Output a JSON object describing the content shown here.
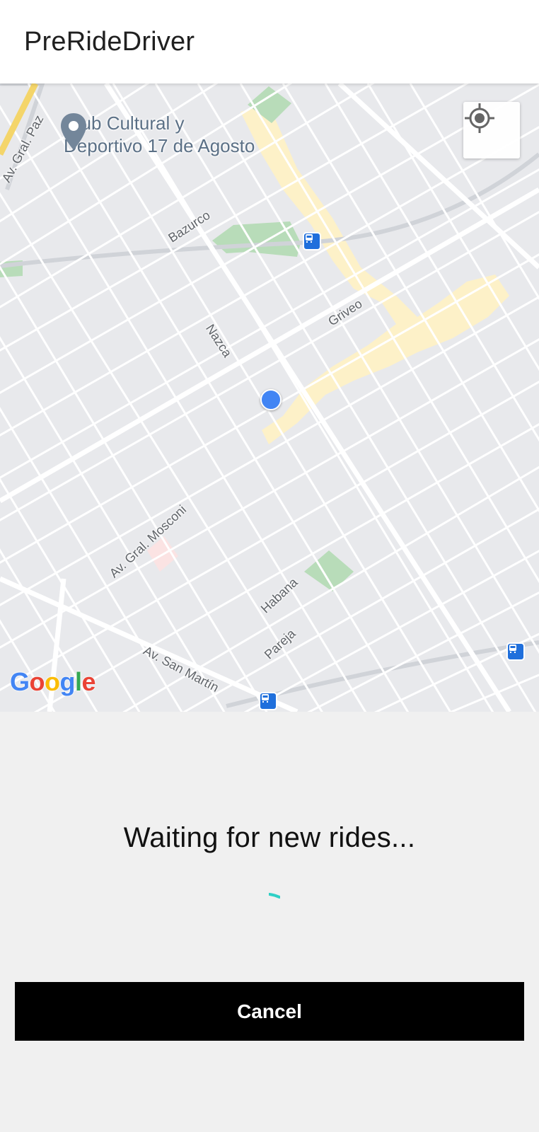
{
  "app": {
    "title": "PreRideDriver"
  },
  "map": {
    "poi": {
      "name_line1": "Club Cultural y",
      "name_line2": "Deportivo 17 de Agosto",
      "icon": "map-pin-icon"
    },
    "street_labels": {
      "gral_paz": "Av. Gral. Paz",
      "bazurco": "Bazurco",
      "nazca": "Nazca",
      "griveo": "Griveo",
      "mosconi": "Av. Gral. Mosconi",
      "habana": "Habana",
      "pareja": "Pareja",
      "san_martin": "Av. San Martín"
    },
    "attribution": {
      "G": "G",
      "o1": "o",
      "o2": "o",
      "g": "g",
      "l": "l",
      "e": "e"
    },
    "icons": {
      "locate": "my-location-icon",
      "transit": "train-station-icon",
      "user": "user-location-dot"
    },
    "colors": {
      "water_highlight": "#fdf1c8",
      "park": "#b8dcb9",
      "road": "#ffffff",
      "user_dot": "#4285f4"
    }
  },
  "status": {
    "message": "Waiting for new rides..."
  },
  "spinner": {
    "icon": "loading-spinner-icon",
    "color": "#2fd0c6"
  },
  "actions": {
    "cancel_label": "Cancel"
  }
}
